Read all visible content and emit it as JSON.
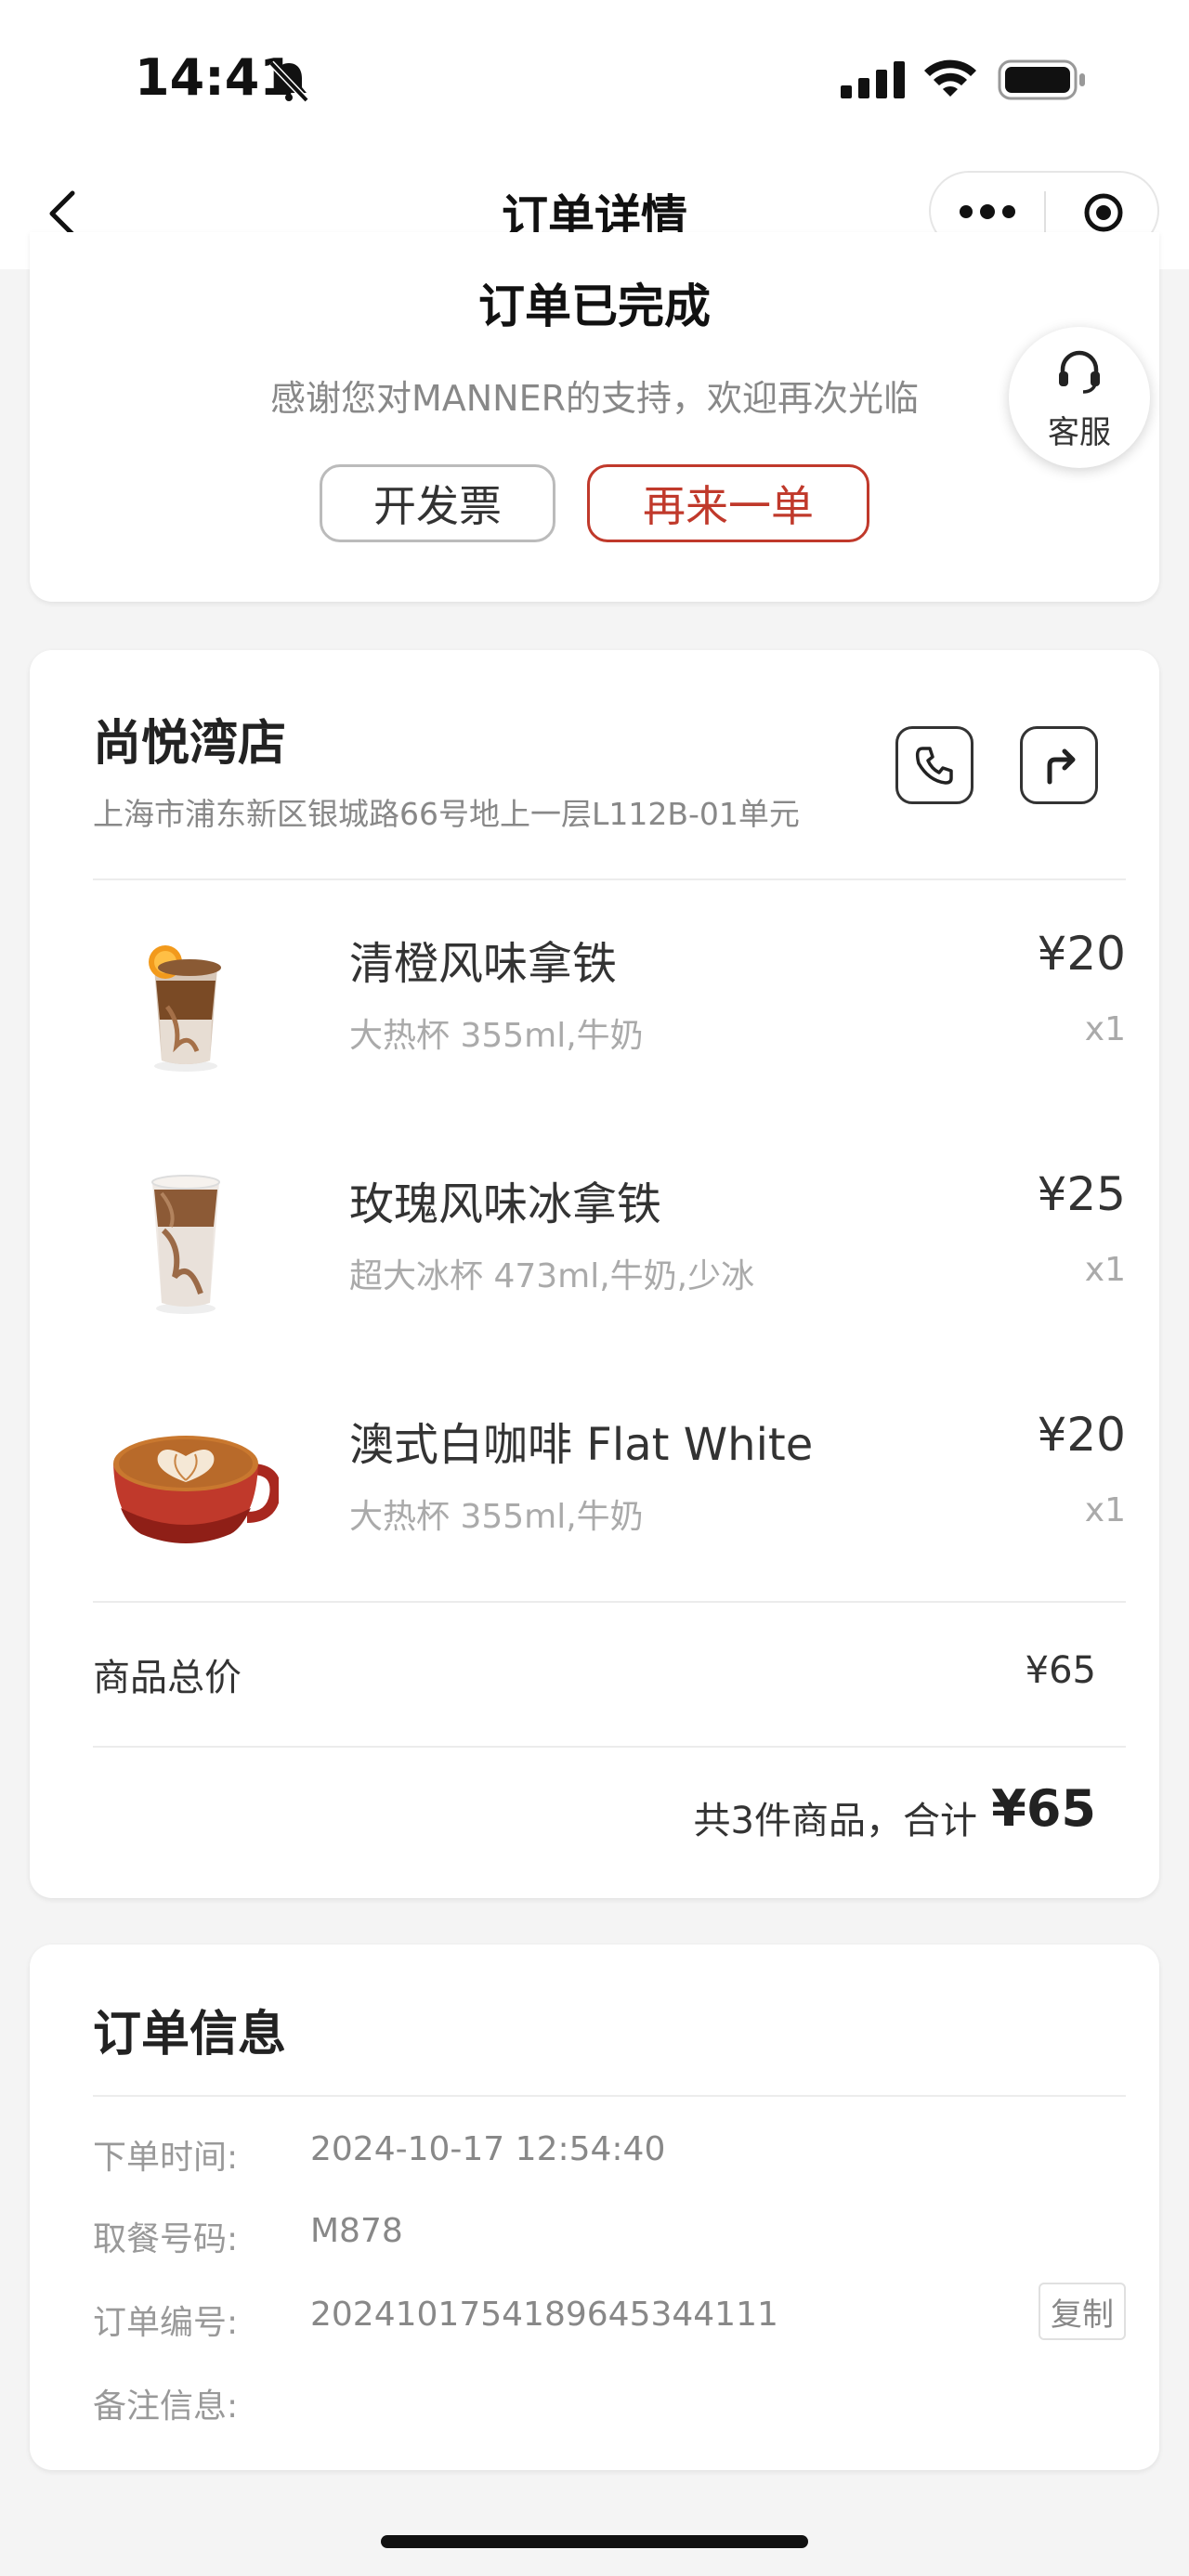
{
  "status_bar": {
    "time": "14:41"
  },
  "nav": {
    "title": "订单详情"
  },
  "order_status": {
    "title": "订单已完成",
    "subtitle": "感谢您对MANNER的支持，欢迎再次光临",
    "invoice_button": "开发票",
    "reorder_button": "再来一单"
  },
  "customer_service": {
    "label": "客服"
  },
  "store": {
    "name": "尚悦湾店",
    "address": "上海市浦东新区银城路66号地上一层L112B-01单元"
  },
  "products": [
    {
      "name": "清橙风味拿铁",
      "spec": "大热杯 355ml,牛奶",
      "price": "¥20",
      "qty": "x1"
    },
    {
      "name": "玫瑰风味冰拿铁",
      "spec": "超大冰杯 473ml,牛奶,少冰",
      "price": "¥25",
      "qty": "x1"
    },
    {
      "name": "澳式白咖啡 Flat White",
      "spec": "大热杯 355ml,牛奶",
      "price": "¥20",
      "qty": "x1"
    }
  ],
  "summary": {
    "total_label": "商品总价",
    "total_value": "¥65",
    "count_label": "共3件商品，合计",
    "sum_value": "¥65"
  },
  "order_info": {
    "title": "订单信息",
    "rows": [
      {
        "label": "下单时间:",
        "value": "2024-10-17 12:54:40"
      },
      {
        "label": "取餐号码:",
        "value": "M878"
      },
      {
        "label": "订单编号:",
        "value": "2024101754189645344111"
      },
      {
        "label": "备注信息:",
        "value": ""
      }
    ],
    "copy_button": "复制"
  },
  "colors": {
    "accent": "#c0392b",
    "background": "#f4f4f4"
  }
}
